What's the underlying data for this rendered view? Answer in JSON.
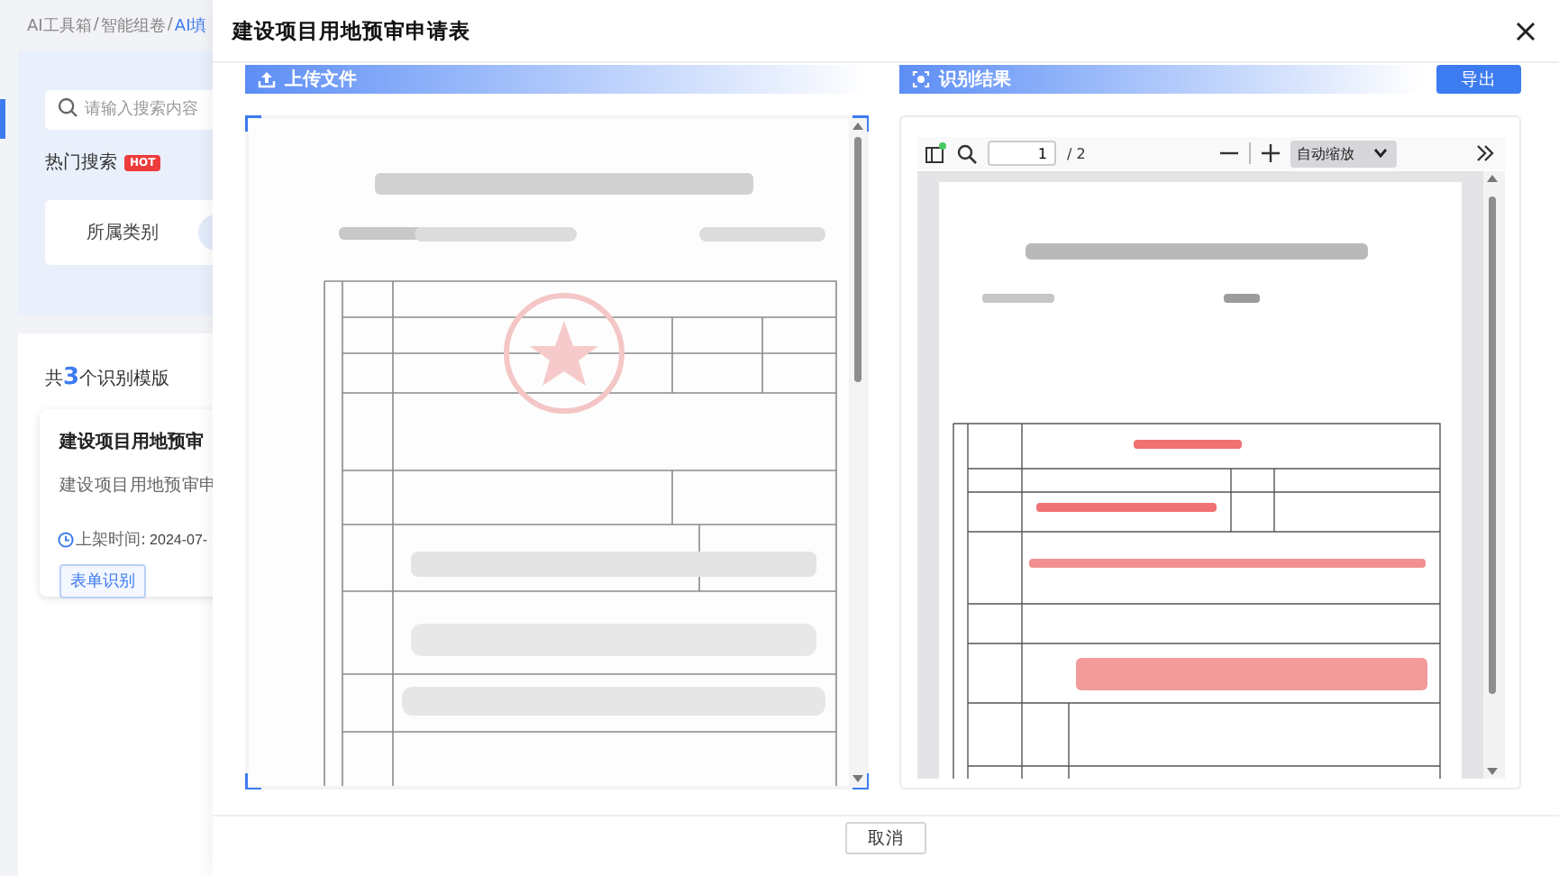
{
  "background": {
    "breadcrumb": {
      "separator": "/",
      "items": [
        {
          "label": "AI工具箱",
          "selected": false
        },
        {
          "label": "智能组卷",
          "selected": false
        },
        {
          "label": "AI填",
          "selected": true
        }
      ]
    },
    "search": {
      "placeholder": "请输入搜索内容"
    },
    "hot_search": {
      "label": "热门搜索",
      "badge": "HOT"
    },
    "filter": {
      "label": "所属类别"
    },
    "results": {
      "prefix": "共",
      "count": "3",
      "suffix": "个识别模版"
    },
    "card": {
      "title": "建设项目用地预审",
      "description": "建设项目用地预审申",
      "time_label": "上架时间:",
      "time": "2024-07-",
      "button": "表单识别"
    }
  },
  "dialog": {
    "title": "建设项目用地预审申请表",
    "upload": {
      "title": "上传文件"
    },
    "result": {
      "title": "识别结果",
      "export_button": "导出",
      "viewer": {
        "page": "1",
        "page_total": "/ 2",
        "zoom": "自动缩放"
      }
    },
    "cancel_button": "取消"
  }
}
